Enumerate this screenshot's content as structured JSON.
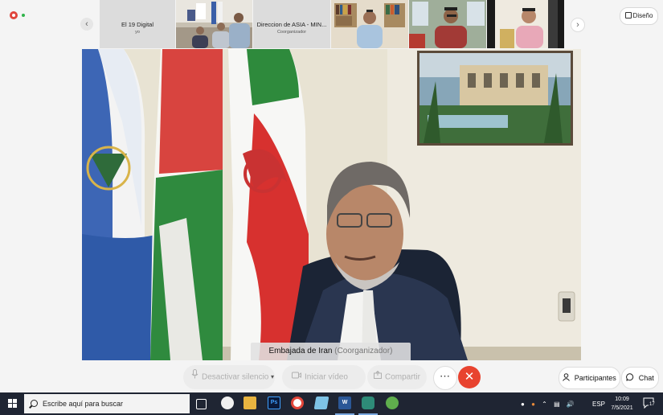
{
  "top_strip": {
    "tiles": [
      {
        "name": "El 19 Digital",
        "subtitle": "yo",
        "kind": "name"
      },
      {
        "name": "",
        "subtitle": "",
        "kind": "video"
      },
      {
        "name": "Direccion de ASIA - MIN...",
        "subtitle": "Coorganizador",
        "kind": "name"
      },
      {
        "name": "",
        "subtitle": "",
        "kind": "video"
      },
      {
        "name": "",
        "subtitle": "",
        "kind": "video"
      },
      {
        "name": "",
        "subtitle": "",
        "kind": "video"
      }
    ],
    "design_button": "Diseño"
  },
  "main_video": {
    "speaker": "Embajada de Iran",
    "role": "(Coorganizador)"
  },
  "controls": {
    "mute": "Desactivar silencio",
    "video": "Iniciar vídeo",
    "share": "Compartir",
    "participants": "Participantes",
    "chat": "Chat",
    "more_icon": "more-icon",
    "hangup_icon": "close-icon"
  },
  "taskbar": {
    "search_placeholder": "Escribe aquí para buscar",
    "language": "ESP",
    "time": "10:09",
    "date": "7/5/2021",
    "notifications": "17"
  },
  "colors": {
    "hangup": "#e8432f",
    "taskbar": "#1f2533",
    "background": "#f4f4f4"
  }
}
